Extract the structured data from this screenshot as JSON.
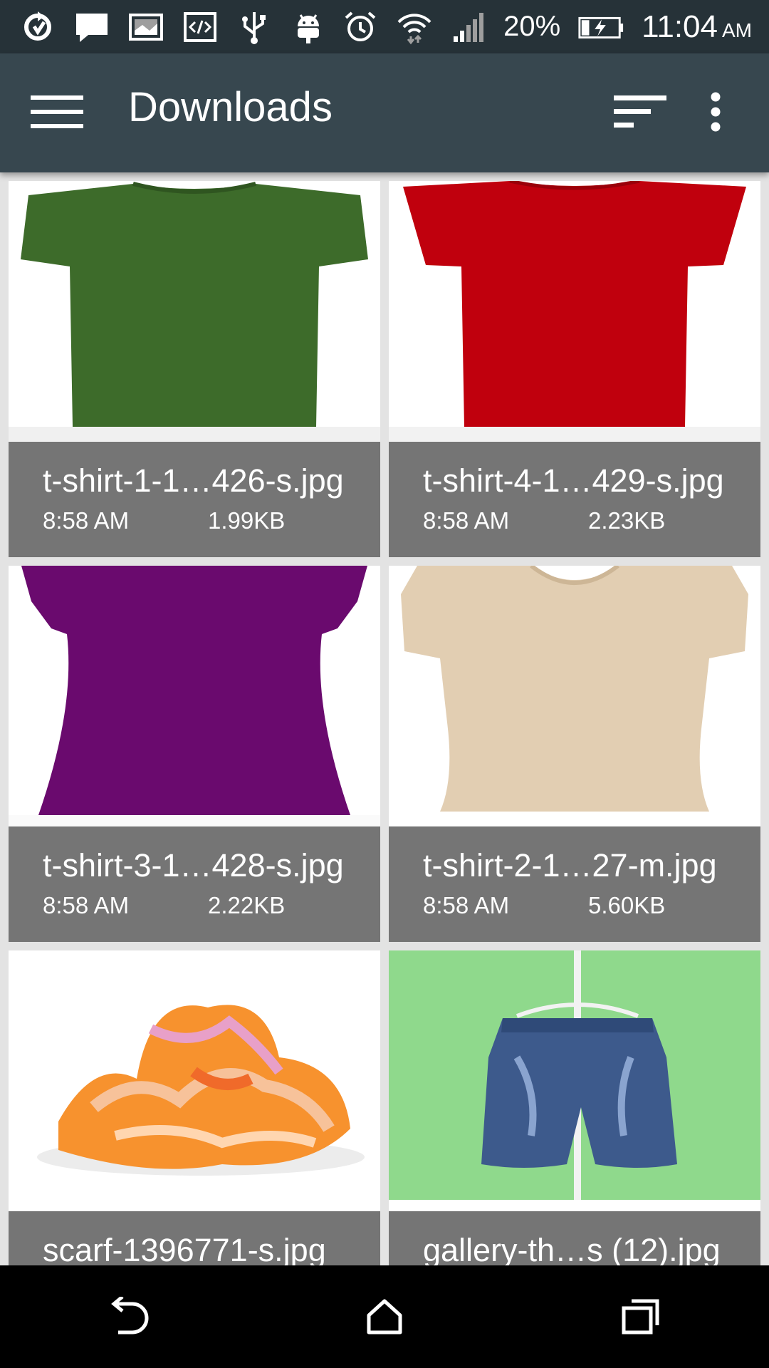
{
  "status_bar": {
    "battery": "20%",
    "time": "11:04",
    "ampm": "AM"
  },
  "app_bar": {
    "title": "Downloads"
  },
  "files": [
    {
      "name": "t-shirt-1-1…426-s.jpg",
      "time": "8:58 AM",
      "size": "1.99KB",
      "thumb": "green-tshirt"
    },
    {
      "name": "t-shirt-4-1…429-s.jpg",
      "time": "8:58 AM",
      "size": "2.23KB",
      "thumb": "red-tshirt"
    },
    {
      "name": "t-shirt-3-1…428-s.jpg",
      "time": "8:58 AM",
      "size": "2.22KB",
      "thumb": "purple-tshirt"
    },
    {
      "name": "t-shirt-2-1…27-m.jpg",
      "time": "8:58 AM",
      "size": "5.60KB",
      "thumb": "beige-tshirt"
    },
    {
      "name": "scarf-1396771-s.jpg",
      "thumb": "orange-scarf"
    },
    {
      "name": "gallery-th…s (12).jpg",
      "thumb": "denim-shorts"
    }
  ],
  "colors": {
    "status_bar": "#263238",
    "app_bar": "#37474f",
    "info_panel": "#757575",
    "green_shirt": "#3d6b2a",
    "red_shirt": "#c0000d",
    "purple_shirt": "#6a0a6e",
    "beige_shirt": "#e2ceb2"
  }
}
